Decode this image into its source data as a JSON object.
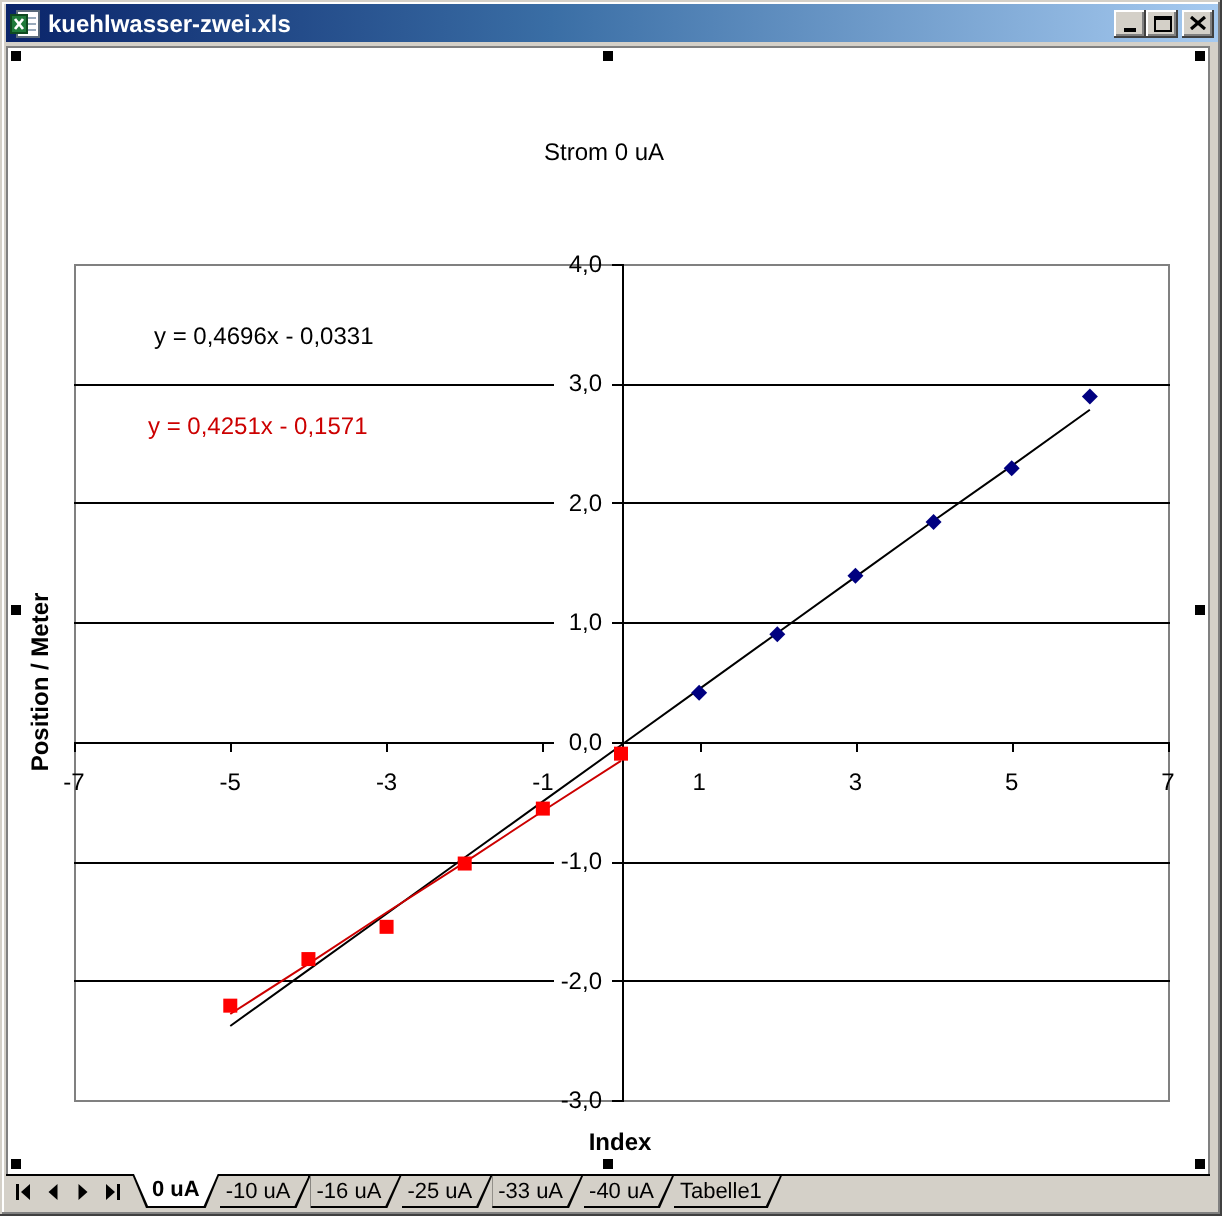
{
  "window": {
    "title": "kuehlwasser-zwei.xls"
  },
  "chart": {
    "chart_data": {
      "type": "scatter",
      "title": "Strom 0 uA",
      "xlabel": "Index",
      "ylabel": "Position / Meter",
      "x": [
        -5,
        -4,
        -3,
        -2,
        -1,
        0,
        1,
        2,
        3,
        4,
        5,
        6
      ],
      "series": [
        {
          "color": "#000080",
          "values": [
            null,
            null,
            null,
            null,
            null,
            null,
            0.41,
            0.9,
            1.39,
            1.84,
            2.29,
            2.89
          ]
        },
        {
          "color": "#ff0000",
          "values": [
            -2.21,
            -1.82,
            -1.55,
            -1.02,
            -0.56,
            -0.1,
            null,
            null,
            null,
            null,
            null,
            null
          ]
        },
        {
          "type": "line",
          "color": "#000000",
          "values": [
            -2.38,
            -1.91,
            -1.44,
            -0.97,
            -0.5,
            -0.03,
            0.44,
            0.91,
            1.38,
            1.85,
            2.31,
            2.78
          ]
        },
        {
          "type": "line",
          "color": "#cc0000",
          "values": [
            -2.28,
            -1.86,
            -1.43,
            -1.01,
            -0.58,
            -0.16,
            null,
            null,
            null,
            null,
            null,
            null
          ]
        }
      ],
      "xlim": [
        -7,
        7
      ],
      "ylim": [
        -3,
        4
      ],
      "xticks": [
        -7,
        -5,
        -3,
        -1,
        1,
        3,
        5,
        7
      ],
      "yticks": [
        {
          "value": 4,
          "label": "4,0"
        },
        {
          "value": 3,
          "label": "3,0"
        },
        {
          "value": 2,
          "label": "2,0"
        },
        {
          "value": 1,
          "label": "1,0"
        },
        {
          "value": 0,
          "label": "0,0"
        },
        {
          "value": -1,
          "label": "-1,0"
        },
        {
          "value": -2,
          "label": "-2,0"
        },
        {
          "value": -3,
          "label": "-3,0"
        }
      ],
      "grid": "y",
      "annotations": [
        "y = 0,4696x - 0,0331",
        "y = 0,4251x - 0,1571"
      ]
    }
  },
  "sheet_tabs": [
    {
      "label": "0 uA",
      "selected": true
    },
    {
      "label": "-10 uA",
      "selected": false
    },
    {
      "label": "-16 uA",
      "selected": false
    },
    {
      "label": "-25 uA",
      "selected": false
    },
    {
      "label": "-33 uA",
      "selected": false
    },
    {
      "label": "-40 uA",
      "selected": false
    },
    {
      "label": "Tabelle1",
      "selected": false
    }
  ]
}
